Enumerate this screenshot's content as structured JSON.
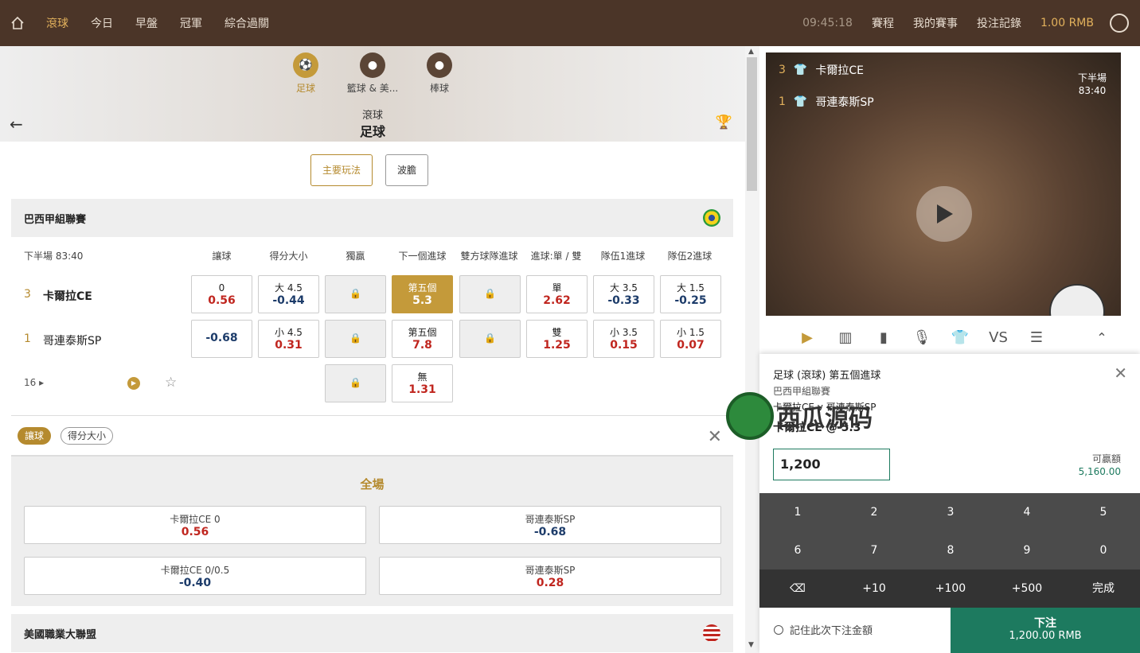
{
  "topbar": {
    "nav": [
      "滾球",
      "今日",
      "早盤",
      "冠軍",
      "綜合過關"
    ],
    "time": "09:45:18",
    "links": [
      "賽程",
      "我的賽事",
      "投注記錄"
    ],
    "balance": "1.00 RMB"
  },
  "sports": [
    "足球",
    "籃球 & 美...",
    "棒球"
  ],
  "hero": {
    "t1": "滾球",
    "t2": "足球"
  },
  "tabs": [
    "主要玩法",
    "波膽"
  ],
  "league1": "巴西甲組聯賽",
  "league2": "美國職業大聯盟",
  "headers": {
    "time": "下半場  83:40",
    "cols": [
      "讓球",
      "得分大小",
      "獨贏",
      "下一個進球",
      "雙方球隊進球",
      "進球:單 / 雙",
      "隊伍1進球",
      "隊伍2進球"
    ]
  },
  "teams": [
    {
      "score": "3",
      "name": "卡爾拉CE"
    },
    {
      "score": "1",
      "name": "哥連泰斯SP"
    }
  ],
  "row1": [
    {
      "a": "0",
      "b": "0.56"
    },
    {
      "a": "大 4.5",
      "b": "-0.44"
    },
    {
      "a": "第五個",
      "b": "5.3"
    },
    {
      "a": "單",
      "b": "2.62"
    },
    {
      "a": "大 3.5",
      "b": "-0.33"
    },
    {
      "a": "大 1.5",
      "b": "-0.25"
    }
  ],
  "row2": [
    {
      "b": "-0.68"
    },
    {
      "a": "小 4.5",
      "b": "0.31"
    },
    {
      "a": "第五個",
      "b": "7.8"
    },
    {
      "a": "雙",
      "b": "1.25"
    },
    {
      "a": "小 3.5",
      "b": "0.15"
    },
    {
      "a": "小 1.5",
      "b": "0.07"
    }
  ],
  "row3": {
    "count": "16",
    "a": "無",
    "b": "1.31"
  },
  "pills": [
    "讓球",
    "得分大小"
  ],
  "full": {
    "title": "全場",
    "boxes": [
      {
        "a": "卡爾拉CE 0",
        "b": "0.56"
      },
      {
        "a": "哥連泰斯SP",
        "b": "-0.68"
      },
      {
        "a": "卡爾拉CE 0/0.5",
        "b": "-0.40"
      },
      {
        "a": "哥連泰斯SP",
        "b": "0.28"
      }
    ]
  },
  "video": {
    "score1": "3",
    "team1": "卡爾拉CE",
    "score2": "1",
    "team2": "哥連泰斯SP",
    "half": "下半場",
    "time": "83:40"
  },
  "slip": {
    "l1": "足球 (滾球) 第五個進球",
    "l2": "巴西甲組聯賽",
    "l3": "卡爾拉CE v 哥連泰斯SP",
    "l4": "卡爾拉CE @ 5.3",
    "amount": "1,200",
    "avail_label": "可贏額",
    "avail": "5,160.00",
    "keys": [
      "1",
      "2",
      "3",
      "4",
      "5",
      "6",
      "7",
      "8",
      "9",
      "0",
      "⌫",
      "+10",
      "+100",
      "+500",
      "完成"
    ],
    "remember": "記住此次下注金額",
    "bet": "下注",
    "bet_amt": "1,200.00 RMB"
  },
  "watermark": "西瓜源码",
  "colors": {
    "brand": "#4b3528",
    "gold": "#c49a3a",
    "green": "#1d7a5f",
    "red": "#c0261f"
  }
}
